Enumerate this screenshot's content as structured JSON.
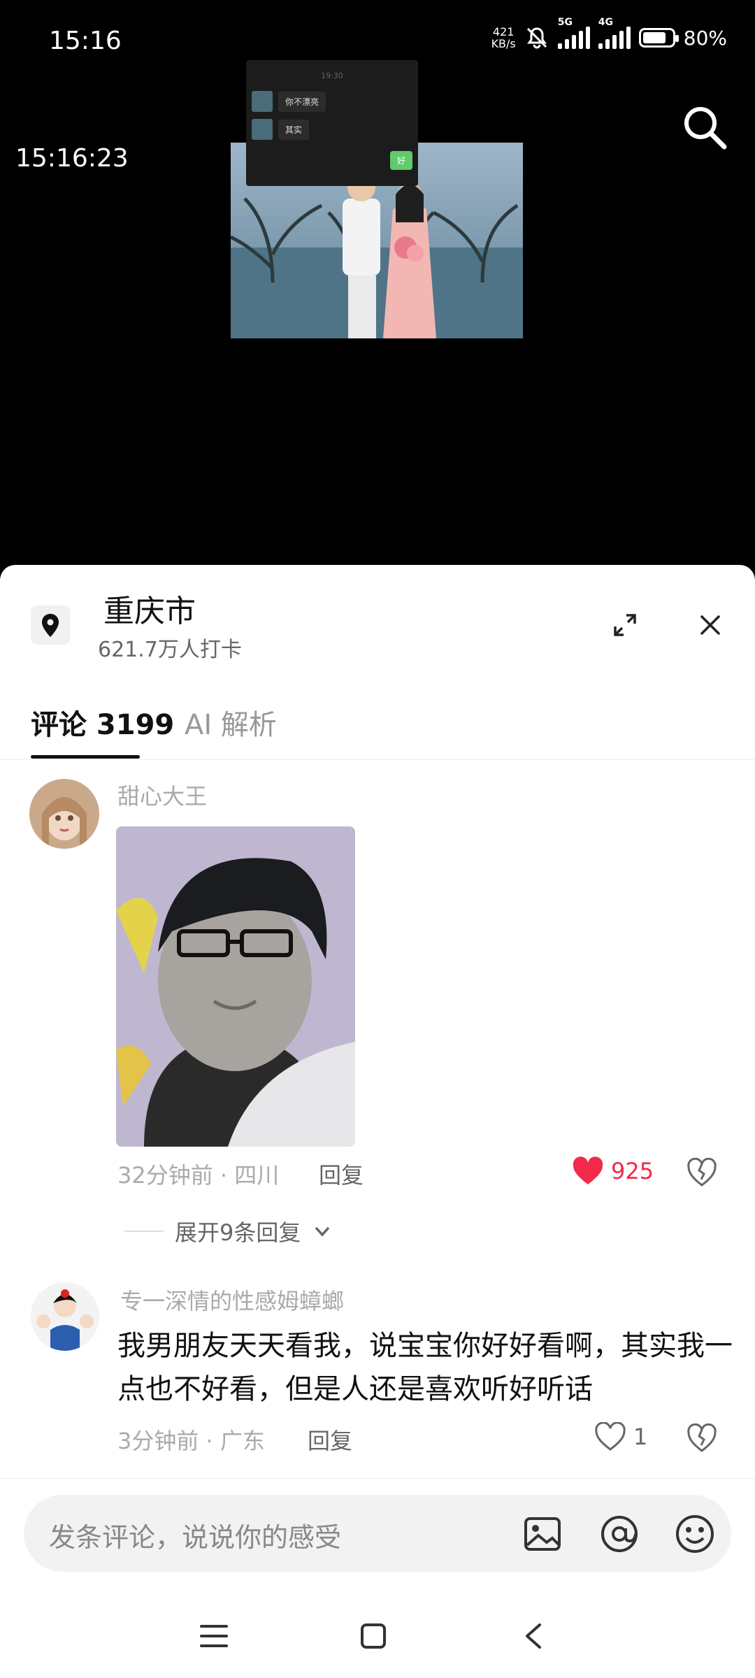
{
  "status_bar": {
    "time": "15:16",
    "net_speed_value": "421",
    "net_speed_unit": "KB/s",
    "sim1_label": "5G",
    "sim2_label": "4G",
    "battery": "80%",
    "icons": [
      "mute-bell-icon",
      "signal-icon",
      "battery-icon"
    ]
  },
  "video": {
    "timestamp": "15:16:23",
    "chat_overlay": {
      "time": "19:30",
      "messages": [
        "你不漂亮",
        "其实"
      ],
      "reply": "好"
    }
  },
  "location": {
    "title": "重庆市",
    "checkins": "621.7万人打卡"
  },
  "tabs": [
    {
      "label": "评论 3199",
      "active": true
    },
    {
      "label": "AI 解析",
      "active": false
    }
  ],
  "comments": [
    {
      "user": "甜心大王",
      "time_loc": "32分钟前 · 四川",
      "reply_label": "回复",
      "likes": "925",
      "liked": true,
      "expand_label": "展开9条回复"
    },
    {
      "user": "专一深情的性感姆蟑螂",
      "text": "我男朋友天天看我，说宝宝你好好看啊，其实我一点也不好看，但是人还是喜欢听好听话",
      "time_loc": "3分钟前 · 广东",
      "reply_label": "回复",
      "likes": "1",
      "liked": false
    }
  ],
  "input": {
    "placeholder": "发条评论，说说你的感受"
  },
  "colors": {
    "like_red": "#f2294b",
    "accent_green": "#5fcb6b"
  }
}
